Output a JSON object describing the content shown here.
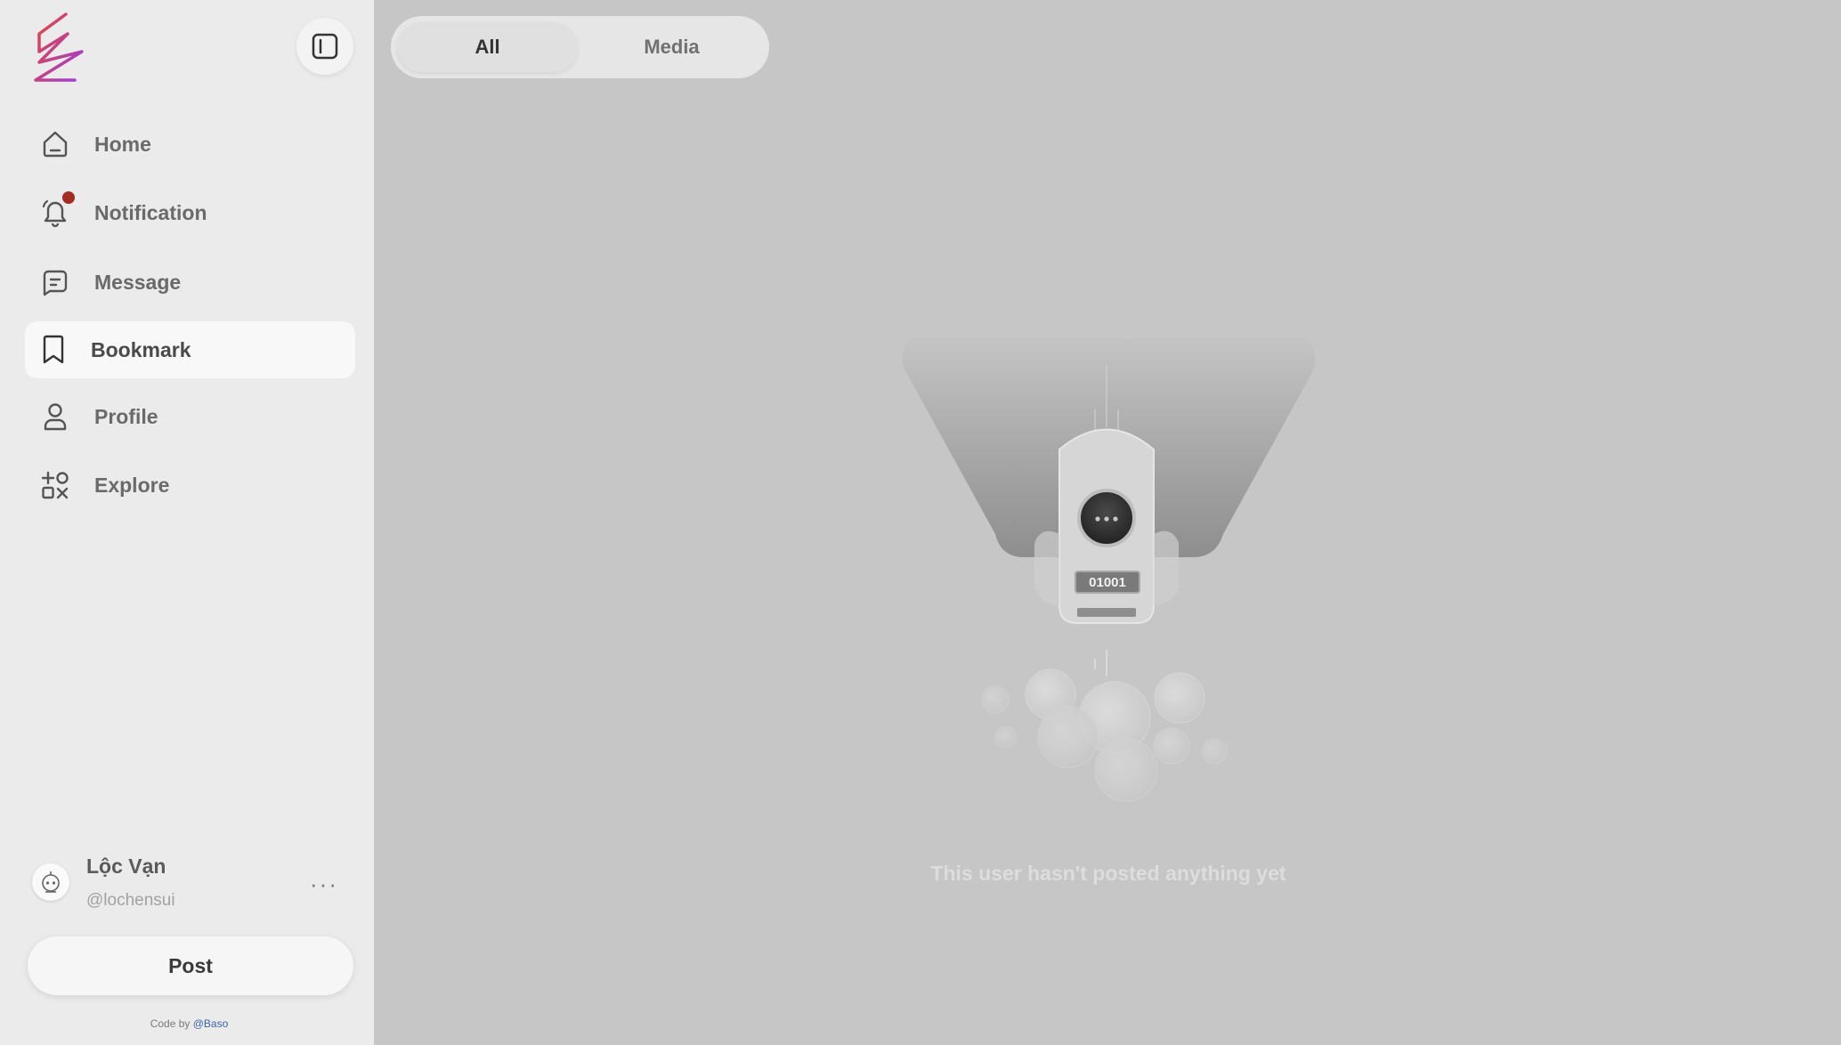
{
  "sidebar": {
    "items": [
      {
        "label": "Home",
        "icon": "home-icon"
      },
      {
        "label": "Notification",
        "icon": "bell-icon",
        "has_unread": true
      },
      {
        "label": "Message",
        "icon": "message-icon"
      },
      {
        "label": "Bookmark",
        "icon": "bookmark-icon",
        "active": true
      },
      {
        "label": "Profile",
        "icon": "user-icon"
      },
      {
        "label": "Explore",
        "icon": "explore-icon"
      }
    ],
    "user": {
      "name": "Lộc Vạn",
      "handle": "@lochensui",
      "more_label": "···"
    },
    "post_label": "Post",
    "credit": {
      "prefix": "Code by ",
      "author": "@Baso"
    }
  },
  "tabs": [
    {
      "label": "All",
      "active": true
    },
    {
      "label": "Media",
      "active": false
    }
  ],
  "main": {
    "robot_display": "01001",
    "empty_message": "This user hasn't posted anything yet"
  },
  "colors": {
    "sidebar_bg": "#ebebeb",
    "content_bg": "#c6c6c6",
    "notification_dot": "#a42a22",
    "logo_gradient": [
      "#e8453c",
      "#9b3fd6"
    ]
  }
}
